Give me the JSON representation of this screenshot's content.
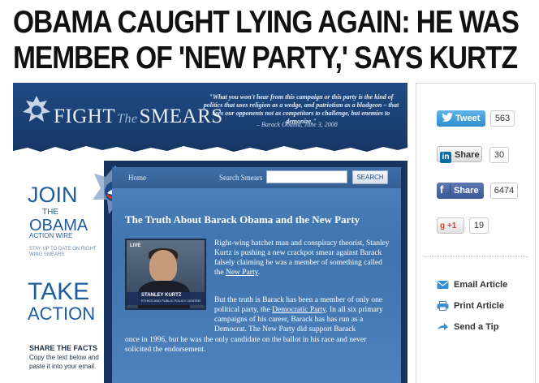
{
  "headline": {
    "line1": "OBAMA CAUGHT LYING AGAIN: HE WAS",
    "line2": "MEMBER OF 'NEW PARTY,' SAYS KURTZ"
  },
  "screenshot": {
    "brand": {
      "fight": "FIGHT",
      "the": "The",
      "smears": "SMEARS"
    },
    "quote": "\"What you won't hear from this campaign or this party is the kind of politics that uses religion as a wedge, and patriotism as a bludgeon – that sees our opponents not as competitors to challenge, but enemies to demonize.\"",
    "quote_attribution": "– Barack Obama, June 3, 2008",
    "left_column": {
      "join": "JOIN",
      "the": "THE",
      "obama": "OBAMA",
      "action_wire": "ACTION WIRE",
      "stay_up": "STAY UP TO DATE ON RIGHT WING SMEARS",
      "take": "TAKE",
      "action": "ACTION",
      "share_facts": "SHARE THE FACTS",
      "copy_text": "Copy the text below and paste it into your email."
    },
    "nav": {
      "home": "Home",
      "search_label": "Search Smears",
      "search_placeholder": "",
      "search_button": "SEARCH"
    },
    "article": {
      "title": "The Truth About Barack Obama and the New Party",
      "video": {
        "live": "LIVE",
        "name": "STANLEY KURTZ",
        "subtitle": "ETHICS AND PUBLIC POLICY CENTER"
      },
      "p1_start": "Right-wing hatchet man and conspiracy theorist, Stanley Kurtz is pushing a new crackpot smear against Barack falsely claiming he was a member of something called the ",
      "p1_link": "New Party",
      "p1_end": ".",
      "p2_start": "But the truth is Barack has been a member of only one political party, the ",
      "p2_link": "Democratic Party",
      "p2_end": ". In all six primary campaigns of his career, Barack has has run as a Democrat. The New Party did support Barack",
      "p3": "once in 1996, but he was the only candidate on the ballot in his race and never solicited the endorsement."
    }
  },
  "sidebar": {
    "share": {
      "tweet_label": "Tweet",
      "tweet_count": "563",
      "linkedin_label": "Share",
      "linkedin_count": "30",
      "facebook_label": "Share",
      "facebook_count": "6474",
      "gplus_label": "+1",
      "gplus_count": "19"
    },
    "tools": {
      "email": "Email Article",
      "print": "Print Article",
      "tip": "Send a Tip"
    }
  },
  "colors": {
    "twitter": "#2e8ecf",
    "linkedin": "#0b6ea8",
    "facebook": "#3b5998",
    "gplus": "#d7442f",
    "smears_navy": "#16325f",
    "tool_icon": "#3a8fd0"
  }
}
